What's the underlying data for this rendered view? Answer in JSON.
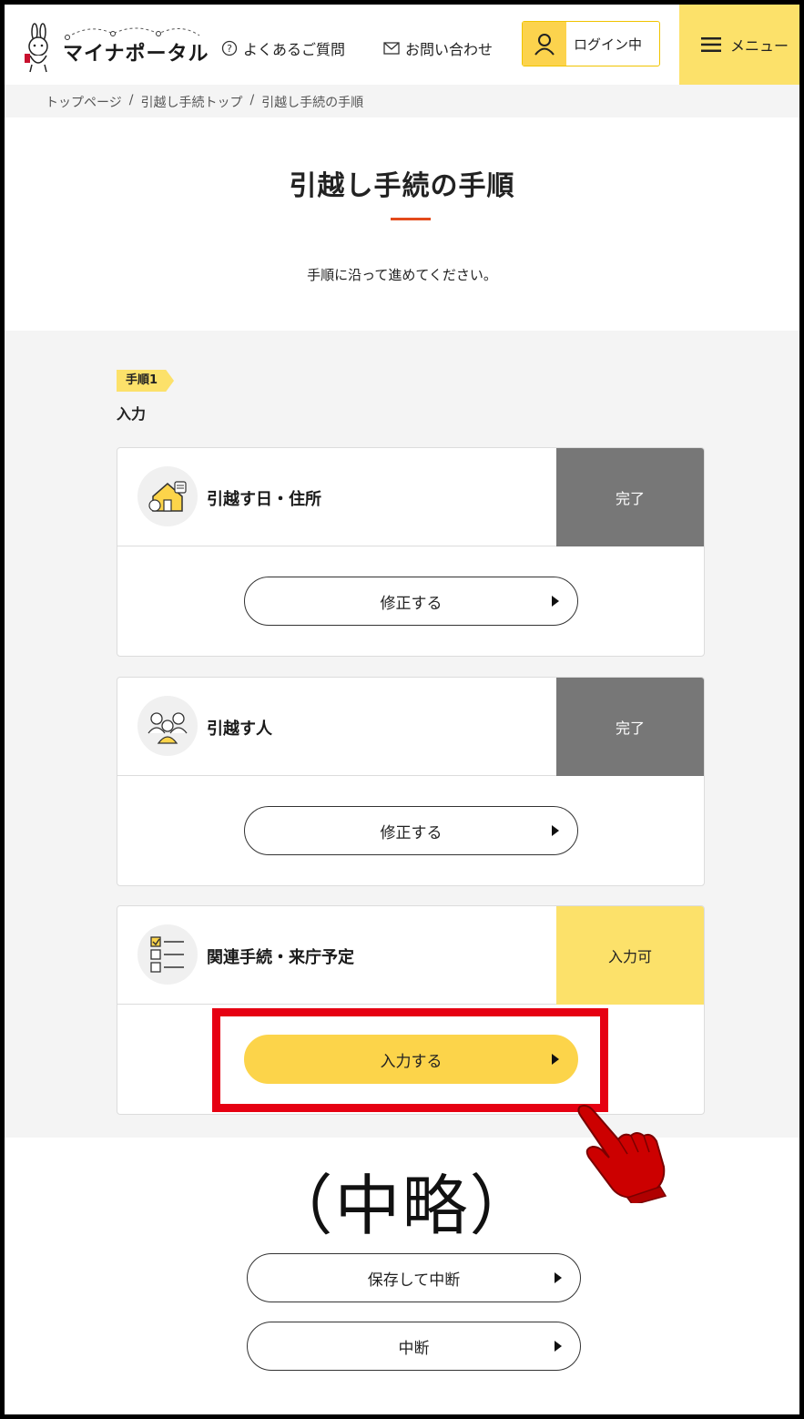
{
  "header": {
    "logo_text": "マイナポータル",
    "faq_label": "よくあるご質問",
    "contact_label": "お問い合わせ",
    "login_label": "ログイン中",
    "menu_label": "メニュー"
  },
  "breadcrumb": {
    "items": [
      "トップページ",
      "引越し手続トップ",
      "引越し手続の手順"
    ],
    "separator": "/"
  },
  "page": {
    "title": "引越し手続の手順",
    "subtitle": "手順に沿って進めてください。"
  },
  "step": {
    "badge": "手順1",
    "label": "入力"
  },
  "cards": [
    {
      "label": "引越す日・住所",
      "status": "完了",
      "button": "修正する",
      "icon": "house-address-icon"
    },
    {
      "label": "引越す人",
      "status": "完了",
      "button": "修正する",
      "icon": "people-icon"
    },
    {
      "label": "関連手続・来庁予定",
      "status": "入力可",
      "button": "入力する",
      "icon": "checklist-icon"
    }
  ],
  "annotation": {
    "omitted_text": "（中略）",
    "highlight_color": "#e60012"
  },
  "footer_buttons": {
    "save_suspend": "保存して中断",
    "suspend": "中断"
  },
  "colors": {
    "accent_yellow": "#fce16a",
    "button_yellow": "#fcd44a",
    "status_done": "#777777",
    "title_rule": "#e34a1b"
  }
}
